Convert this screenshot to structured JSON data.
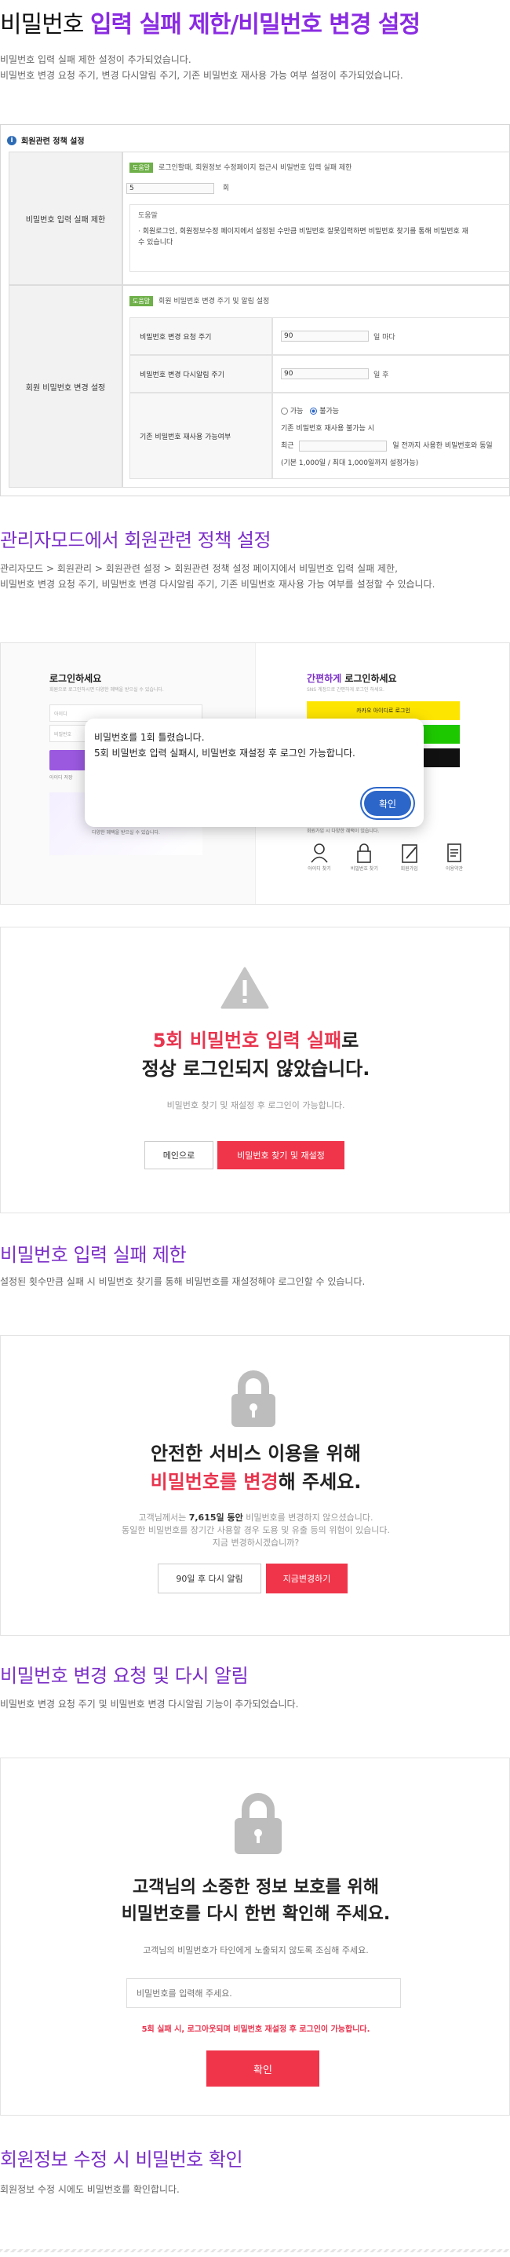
{
  "header": {
    "title_plain": "비밀번호",
    "title_accent": "입력 실패 제한/비밀번호 변경 설정",
    "desc_line1": "비밀번호 입력 실패 제한 설정이 추가되었습니다.",
    "desc_line2": "비밀번호 변경 요청 주기, 변경 다시알림 주기, 기존 비밀번호 재사용 가능 여부 설정이 추가되었습니다."
  },
  "admin_panel": {
    "heading": "회원관련 정책 설정",
    "row1_label": "비밀번호 입력 실패 제한",
    "row1_tag": "도움말",
    "row1_hint": "로그인할때, 회원정보 수정페이지 접근시 비밀번호 입력 실패 제한",
    "row1_value": "5",
    "row1_unit": "회",
    "row1_help_title": "도움말",
    "row1_help_line1": "· 회원로그인, 회원정보수정 페이지에서 설정된 수만큼 비밀번호 잘못입력하면 비밀번호 찾기를 통해 비밀번호 재",
    "row1_help_line2": "수 있습니다",
    "row2_label": "회원 비밀번호 변경 설정",
    "row2_tag": "도움말",
    "row2_hint": "회원 비밀번호 변경 주기 및 알림 설정",
    "sub1_label": "비밀번호 변경 요청 주기",
    "sub1_value": "90",
    "sub1_unit": "일 마다",
    "sub2_label": "비밀번호 변경 다시알림 주기",
    "sub2_value": "90",
    "sub2_unit": "일 후",
    "sub3_label": "기존 비밀번호 재사용 가능여부",
    "sub3_opt1": "가능",
    "sub3_opt2": "불가능",
    "sub3_line1": "기존 비밀번호 재사용 불가능 시",
    "sub3_line2_a": "최근",
    "sub3_line2_b": "일 전까지 사용한 비밀번호와 동일",
    "sub3_line3": "(기본 1,000일 / 최대 1,000일까지 설정가능)"
  },
  "section1": {
    "title": "관리자모드에서 회원관련 정책 설정",
    "desc_line1": "관리자모드 > 회원관리 > 회원관련 설정 > 회원관련 정책 설정 페이지에서 비밀번호 입력 실패 제한,",
    "desc_line2": "비밀번호 변경 요청 주기, 비밀번호 변경 다시알림 주기, 기존 비밀번호 재사용 가능 여부를 설정할 수 있습니다."
  },
  "login_mock": {
    "left_title": "로그인하세요",
    "left_sub": "회원으로 로그인하시면 다양한 혜택을 받으실 수 있습니다.",
    "left_id": "아이디",
    "left_pw": "비밀번호",
    "left_link": "아이디 저장",
    "left_caption1": "지금 회원가입 하시면",
    "left_caption2": "다양한 혜택을 받으실 수 있습니다.",
    "right_title_accent": "간편하게",
    "right_title_rest": " 로그인하세요",
    "right_sub": "SNS 계정으로 간편하게 로그인 하세요.",
    "kakao": "카카오 아이디로 로그인",
    "bottom_caption": "회원가입 시 다양한 혜택이 있습니다.",
    "icons": [
      {
        "name": "find-id-icon",
        "label": "아이디 찾기"
      },
      {
        "name": "find-password-icon",
        "label": "비밀번호 찾기"
      },
      {
        "name": "join-icon",
        "label": "회원가입"
      },
      {
        "name": "terms-icon",
        "label": "이용약관"
      }
    ],
    "dialog_line1": "비밀번호를 1회 틀렸습니다.",
    "dialog_line2": "5회 비밀번호 입력 실패시, 비밀번호 재설정 후 로그인 가능합니다.",
    "dialog_btn": "확인"
  },
  "fail_card": {
    "line1_red": "5회 비밀번호 입력 실패",
    "line1_rest": "로",
    "line2": "정상 로그인되지 않았습니다.",
    "sub": "비밀번호 찾기 및 재설정 후 로그인이 가능합니다.",
    "btn_main": "메인으로",
    "btn_reset": "비밀번호 찾기 및 재설정"
  },
  "section2": {
    "title": "비밀번호 입력 실패 제한",
    "desc": "설정된 횟수만큼 실패 시 비밀번호 찾기를 통해 비밀번호를 재설정해야 로그인할 수 있습니다."
  },
  "change_card": {
    "line1": "안전한 서비스 이용을 위해",
    "line2_red": "비밀번호를 변경",
    "line2_rest": "해 주세요.",
    "info1_a": "고객님께서는 ",
    "info1_b": "7,615일 동안",
    "info1_c": " 비밀번호를 변경하지 않으셨습니다.",
    "info2": "동일한 비밀번호를 장기간 사용할 경우 도용 및 유출 등의 위험이 있습니다.",
    "info3": "지금 변경하시겠습니까?",
    "btn_later": "90일 후 다시 알림",
    "btn_now": "지금변경하기"
  },
  "section3": {
    "title": "비밀번호 변경 요청 및 다시 알림",
    "desc": "비밀번호 변경 요청 주기 및 비밀번호 변경 다시알림 기능이 추가되었습니다."
  },
  "confirm_card": {
    "line1": "고객님의 소중한 정보 보호를 위해",
    "line2": "비밀번호를 다시 한번 확인해 주세요.",
    "sub": "고객님의 비밀번호가 타인에게 노출되지 않도록 조심해 주세요.",
    "placeholder": "비밀번호를 입력해 주세요.",
    "warn": "5회 실패 시, 로그아웃되며 비밀번호 재설정 후 로그인이 가능합니다.",
    "btn": "확인"
  },
  "section4": {
    "title": "회원정보 수정 시 비밀번호 확인",
    "desc": "회원정보 수정 시에도 비밀번호를 확인합니다."
  },
  "colors": {
    "accent_purple": "#7b2ec7",
    "red": "#f0354a",
    "kakao_yellow": "#fee500",
    "naver_green": "#1ec800",
    "dialog_blue": "#2c66c9"
  }
}
